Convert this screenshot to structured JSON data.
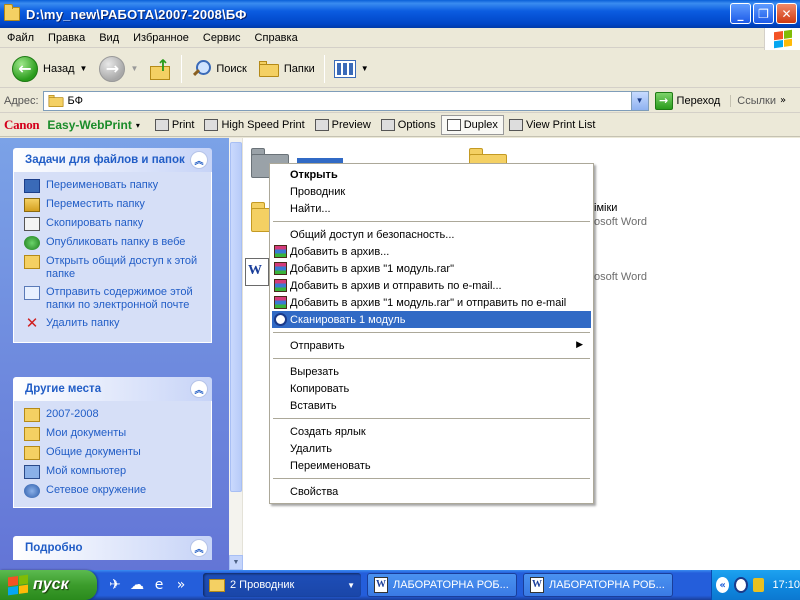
{
  "window": {
    "title": "D:\\my_new\\РАБОТА\\2007-2008\\БФ",
    "minimize_glyph": "_",
    "restore_glyph": "❐",
    "close_glyph": "✕"
  },
  "menu": [
    "Файл",
    "Правка",
    "Вид",
    "Избранное",
    "Сервис",
    "Справка"
  ],
  "toolbar": {
    "back_label": "Назад",
    "back_glyph": "←",
    "forward_glyph": "→",
    "search_label": "Поиск",
    "folders_label": "Папки"
  },
  "address": {
    "label": "Адрес:",
    "value": "БФ",
    "go_label": "Переход",
    "links_label": "Ссылки",
    "links_chevron": "»"
  },
  "canon": {
    "logo": "Canon",
    "product": "Easy-WebPrint",
    "product_caret": "▾",
    "print": "Print",
    "hs_print": "High Speed Print",
    "preview": "Preview",
    "options": "Options",
    "duplex": "Duplex",
    "view_list": "View Print List"
  },
  "tasks_panel": {
    "title": "Задачи для файлов и папок",
    "items": [
      {
        "label": "Переименовать папку",
        "icon": "rename-icon"
      },
      {
        "label": "Переместить папку",
        "icon": "move-icon"
      },
      {
        "label": "Скопировать папку",
        "icon": "copy-icon"
      },
      {
        "label": "Опубликовать папку в вебе",
        "icon": "web-publish-icon"
      },
      {
        "label": "Открыть общий доступ к этой папке",
        "icon": "share-icon"
      },
      {
        "label": "Отправить содержимое этой папки по электронной почте",
        "icon": "mail-icon"
      },
      {
        "label": "Удалить папку",
        "icon": "delete-icon",
        "glyph": "✕"
      }
    ]
  },
  "places_panel": {
    "title": "Другие места",
    "items": [
      {
        "label": "2007-2008",
        "icon": "folder-icon"
      },
      {
        "label": "Мои документы",
        "icon": "my-documents-icon"
      },
      {
        "label": "Общие документы",
        "icon": "shared-documents-icon"
      },
      {
        "label": "Мой компьютер",
        "icon": "my-computer-icon"
      },
      {
        "label": "Сетевое окружение",
        "icon": "network-icon"
      }
    ]
  },
  "details_panel": {
    "title": "Подробно"
  },
  "collapse_glyph": "︽",
  "files": {
    "text1": "іміки",
    "text2": "osoft Word",
    "text3": "osoft Word",
    "word_glyph": "W"
  },
  "context_menu": [
    {
      "type": "item",
      "label": "Открыть",
      "bold": true
    },
    {
      "type": "item",
      "label": "Проводник"
    },
    {
      "type": "item",
      "label": "Найти..."
    },
    {
      "type": "sep"
    },
    {
      "type": "item",
      "label": "Общий доступ и безопасность..."
    },
    {
      "type": "item",
      "label": "Добавить в архив...",
      "icon": "rar"
    },
    {
      "type": "item",
      "label": "Добавить в архив \"1 модуль.rar\"",
      "icon": "rar"
    },
    {
      "type": "item",
      "label": "Добавить в архив и отправить по e-mail...",
      "icon": "rar"
    },
    {
      "type": "item",
      "label": "Добавить в архив \"1 модуль.rar\" и отправить по e-mail",
      "icon": "rar"
    },
    {
      "type": "item",
      "label": "Сканировать 1 модуль",
      "icon": "scan",
      "highlight": true
    },
    {
      "type": "sep"
    },
    {
      "type": "item",
      "label": "Отправить",
      "submenu": true
    },
    {
      "type": "sep"
    },
    {
      "type": "item",
      "label": "Вырезать"
    },
    {
      "type": "item",
      "label": "Копировать"
    },
    {
      "type": "item",
      "label": "Вставить"
    },
    {
      "type": "sep"
    },
    {
      "type": "item",
      "label": "Создать ярлык"
    },
    {
      "type": "item",
      "label": "Удалить"
    },
    {
      "type": "item",
      "label": "Переименовать"
    },
    {
      "type": "sep"
    },
    {
      "type": "item",
      "label": "Свойства"
    }
  ],
  "submenu_arrow": "▶",
  "taskbar": {
    "start_label": "пуск",
    "explorer_btn": "2 Проводник",
    "word_btn_1": "ЛАБОРАТОРНА РОБ...",
    "word_btn_2": "ЛАБОРАТОРНА РОБ...",
    "tray_chevron": "«",
    "clock": "17:10"
  },
  "colors": {
    "accent_blue": "#316ac5",
    "task_link": "#215dc6",
    "canon_red": "#d4001c",
    "canon_green": "#1a8c2a"
  }
}
